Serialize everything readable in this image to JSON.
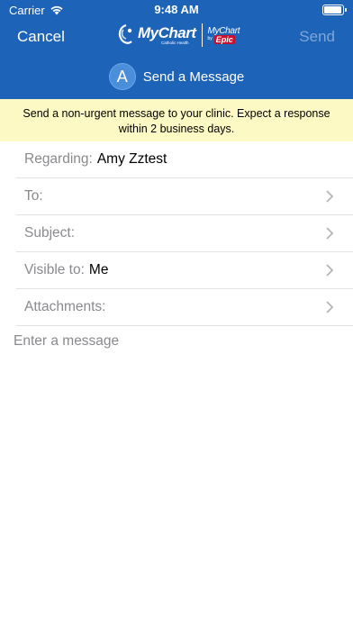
{
  "status": {
    "carrier": "Carrier",
    "time": "9:48 AM"
  },
  "nav": {
    "cancel": "Cancel",
    "send": "Send",
    "logo_main": "MyChart",
    "logo_sub": "Catholic Health",
    "logo_epic_small": "MyChart",
    "logo_epic_by": "by",
    "logo_epic_badge": "Epic"
  },
  "header": {
    "avatar_initial": "A",
    "title": "Send a Message"
  },
  "notice": "Send a non-urgent message to your clinic. Expect a response within 2 business days.",
  "fields": {
    "regarding": {
      "label": "Regarding:",
      "value": "Amy Zztest"
    },
    "to": {
      "label": "To:",
      "value": ""
    },
    "subject": {
      "label": "Subject:",
      "value": ""
    },
    "visible_to": {
      "label": "Visible to:",
      "value": "Me"
    },
    "attachments": {
      "label": "Attachments:",
      "value": ""
    }
  },
  "message": {
    "placeholder": "Enter a message"
  },
  "colors": {
    "header_bg": "#1d63b8",
    "notice_bg": "#fdf9c4",
    "send_disabled": "#7ea6d9"
  },
  "icons": [
    "wifi-icon",
    "battery-icon",
    "chevron-right-icon",
    "mychart-logo"
  ]
}
